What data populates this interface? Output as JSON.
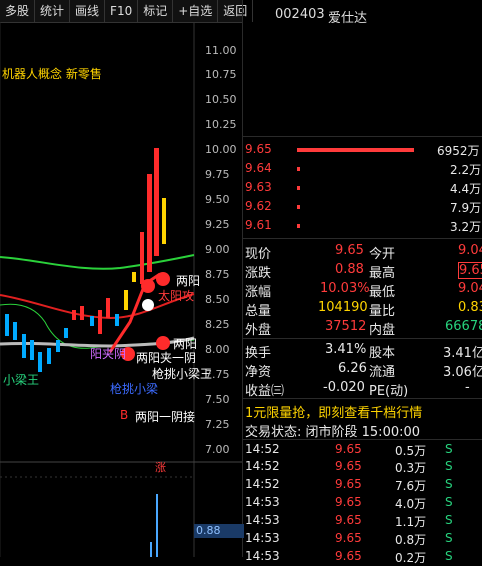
{
  "toolbar": {
    "tabs": [
      "多股",
      "统计",
      "画线",
      "F10",
      "标记",
      "+自选",
      "返回"
    ]
  },
  "stock": {
    "code": "002403",
    "name": "爱仕达"
  },
  "concept_label": "机器人概念 新零售",
  "yaxis": [
    "11.00",
    "10.75",
    "10.50",
    "10.25",
    "10.00",
    "9.75",
    "9.50",
    "9.25",
    "9.00",
    "8.75",
    "8.50",
    "8.25",
    "8.00",
    "7.75",
    "7.50",
    "7.25",
    "7.00"
  ],
  "volume_value": "0.88",
  "limit_up_tag": "涨",
  "signals": [
    "两阳",
    "太阳攻",
    "两阳",
    "两阳夹一阴",
    "阳夹阴",
    "枪挑小梁王",
    "小梁王",
    "枪挑小梁",
    "两阳一阴接",
    "B"
  ],
  "orderbook": [
    {
      "price": "9.65",
      "vol": "6952万",
      "bar": 1.0
    },
    {
      "price": "9.64",
      "vol": "2.2万",
      "bar": 0.0
    },
    {
      "price": "9.63",
      "vol": "4.4万",
      "bar": 0.0
    },
    {
      "price": "9.62",
      "vol": "7.9万",
      "bar": 0.0
    },
    {
      "price": "9.61",
      "vol": "3.2万",
      "bar": 0.0
    }
  ],
  "info": [
    {
      "k1": "现价",
      "v1": "9.65",
      "c1": "red",
      "k2": "今开",
      "v2": "9.04",
      "c2": "red"
    },
    {
      "k1": "涨跌",
      "v1": "0.88",
      "c1": "red",
      "k2": "最高",
      "v2": "9.65",
      "c2": "red"
    },
    {
      "k1": "涨幅",
      "v1": "10.03%",
      "c1": "red",
      "k2": "最低",
      "v2": "9.04",
      "c2": "red"
    },
    {
      "k1": "总量",
      "v1": "104190",
      "c1": "yellow",
      "k2": "量比",
      "v2": "0.83",
      "c2": "yellow"
    },
    {
      "k1": "外盘",
      "v1": "37512",
      "c1": "red",
      "k2": "内盘",
      "v2": "66678",
      "c2": "green"
    },
    {
      "k1": "换手",
      "v1": "3.41%",
      "c1": "white",
      "k2": "股本",
      "v2": "3.41亿",
      "c2": "white"
    },
    {
      "k1": "净资",
      "v1": "6.26",
      "c1": "white",
      "k2": "流通",
      "v2": "3.06亿",
      "c2": "white"
    },
    {
      "k1": "收益㈢",
      "v1": "-0.020",
      "c1": "white",
      "k2": "PE(动)",
      "v2": "-",
      "c2": "white"
    }
  ],
  "promo": "1元限量抢，即刻查看千档行情",
  "trade_status": "交易状态: 闭市阶段 15:00:00",
  "trades": [
    {
      "t": "14:52",
      "p": "9.65",
      "v": "0.5万",
      "s": "S"
    },
    {
      "t": "14:52",
      "p": "9.65",
      "v": "0.3万",
      "s": "S"
    },
    {
      "t": "14:52",
      "p": "9.65",
      "v": "7.6万",
      "s": "S"
    },
    {
      "t": "14:53",
      "p": "9.65",
      "v": "4.0万",
      "s": "S"
    },
    {
      "t": "14:53",
      "p": "9.65",
      "v": "1.1万",
      "s": "S"
    },
    {
      "t": "14:53",
      "p": "9.65",
      "v": "0.8万",
      "s": "S"
    },
    {
      "t": "14:53",
      "p": "9.65",
      "v": "0.2万",
      "s": "S"
    }
  ]
}
